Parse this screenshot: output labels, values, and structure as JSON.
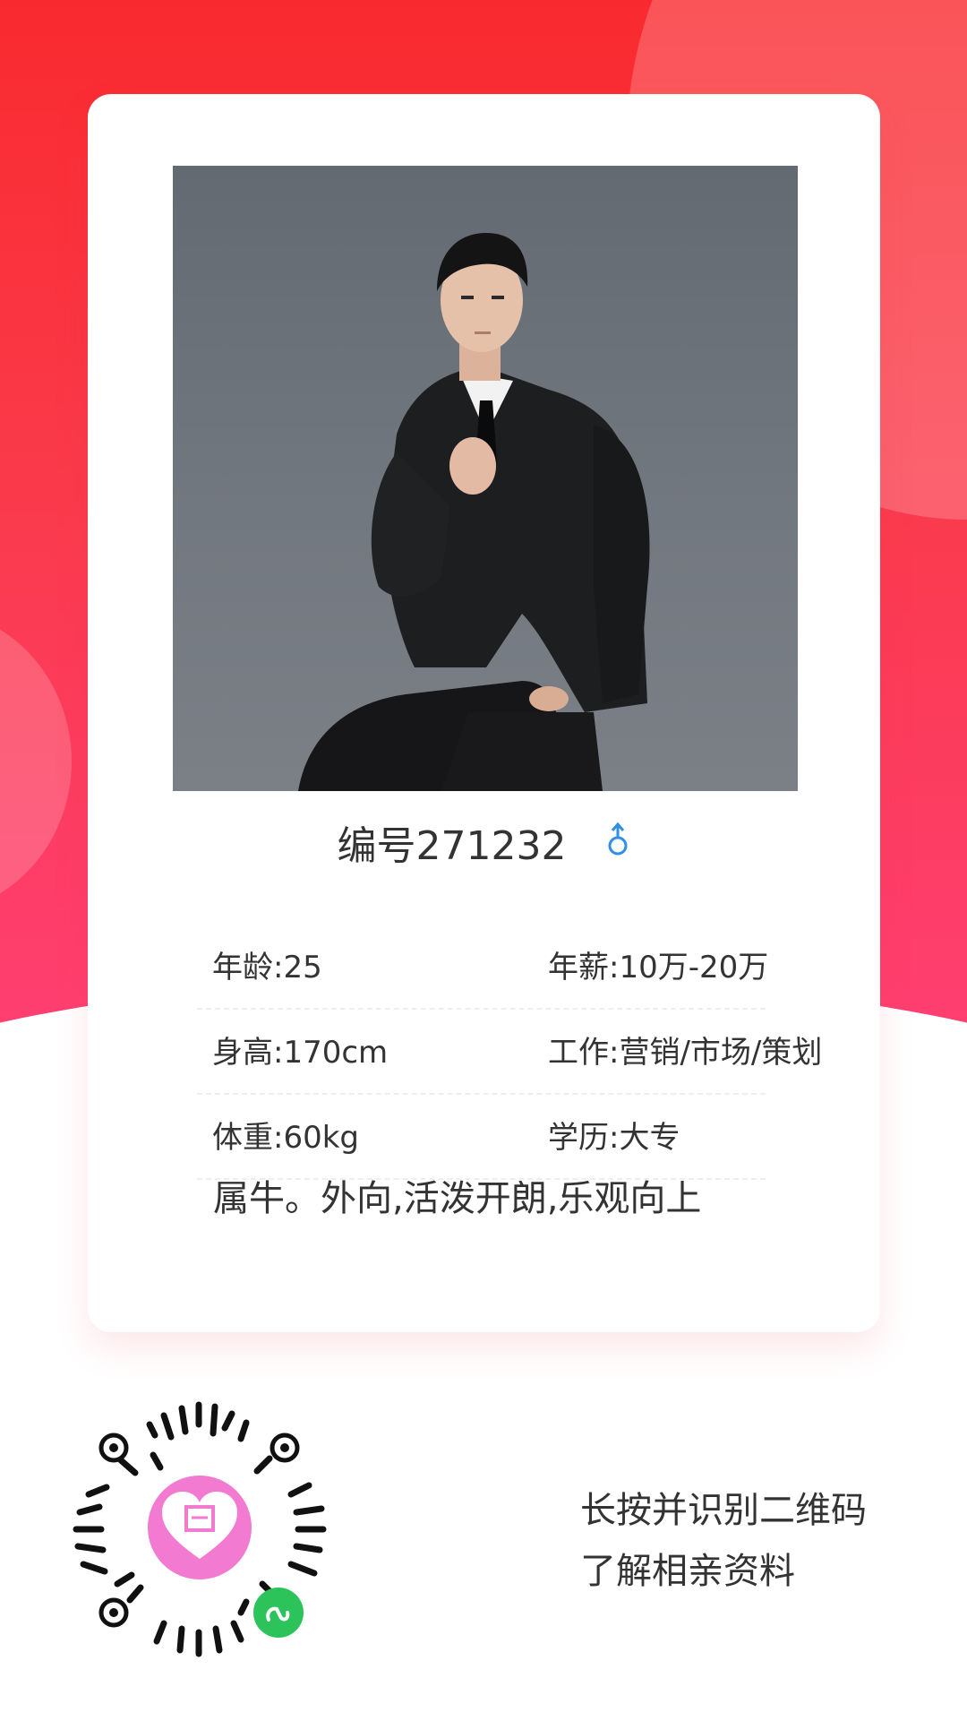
{
  "profile": {
    "id_label": "编号271232",
    "gender_icon": "male-icon",
    "details": [
      {
        "left": "年龄:25",
        "right": "年薪:10万-20万"
      },
      {
        "left": "身高:170cm",
        "right": "工作:营销/市场/策划"
      },
      {
        "left": "体重:60kg",
        "right": "学历:大专"
      }
    ],
    "bio": "属牛。外向,活泼开朗,乐观向上"
  },
  "qr": {
    "line1": "长按并识别二维码",
    "line2": "了解相亲资料",
    "logo_icon": "heart-logo-icon",
    "badge_icon": "mini-program-icon"
  },
  "colors": {
    "accent_red": "#f92a2f",
    "accent_pink": "#ff3f73",
    "male_blue": "#2d8fe6",
    "logo_pink": "#f27ad0",
    "badge_green": "#2bc35a"
  }
}
